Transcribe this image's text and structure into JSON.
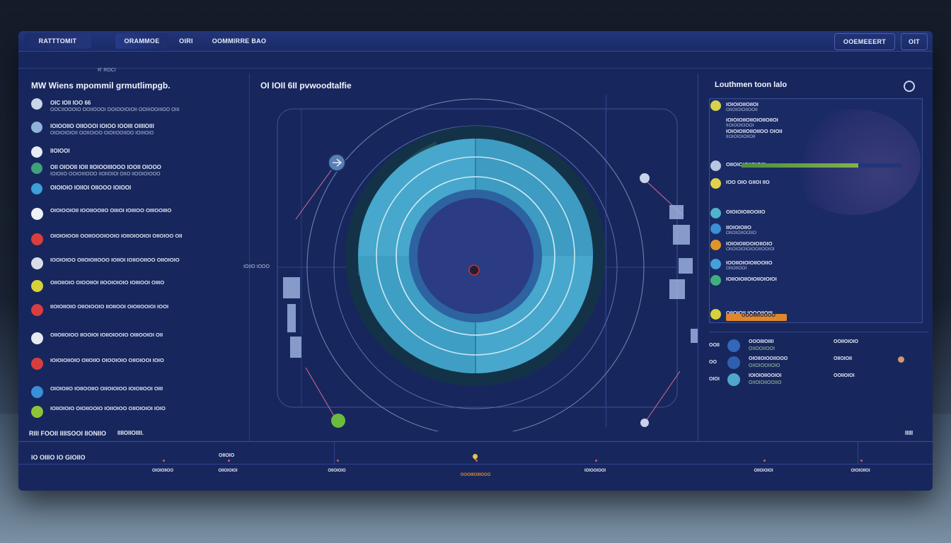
{
  "topbar": {
    "tabs": [
      "RATTTOMIT",
      "ORAMMOE",
      "OIRI",
      "OOMMIRRE BAO"
    ],
    "right_buttons": [
      "OOEMEEERT",
      "OIT"
    ]
  },
  "left_panel": {
    "mini_label": "R’ ROCI",
    "title": "MW Wiens mpommil grmutlimpgb.",
    "rows": [
      {
        "icon": "info-icon",
        "color": "#c9d6ea",
        "line1": "OIC IOII IOO 66",
        "line2": "OOCIIOOOIO OOIIOOOI OOIOOIOIOII OOIIIOOIIIOO OIII"
      },
      {
        "icon": "cloud-icon",
        "color": "#8fb3d8",
        "line1": "IOIOOIIO OIIOOOI IOIOO IOOIII OIIIIOIII",
        "line2": "OIOIOIOIOII OOIIOIOO OIOIIOOIIOO IOIIIOIO"
      },
      {
        "icon": "drop-icon",
        "color": "#e8ecf5",
        "line1": "IIOIOOI",
        "line2": ""
      },
      {
        "icon": "leaf-icon",
        "color": "#3fa07c",
        "line1": "OII OIOOII IOII IIOIOOIIIOOO IOOII OIOOO",
        "line2": "IOIOIIO OOIOIIIOOO IIOIIOIOI OIIO IIOOIOIOOO"
      },
      {
        "icon": "water-icon",
        "color": "#3ea0d8",
        "line1": "OIOIOIO IOIIOI OIIOOO IOIOOI",
        "line2": ""
      }
    ],
    "paragraphs": [
      {
        "icon": "drop-icon",
        "color": "#eef1f7",
        "text": "OIOIOOIOII IOOIIOOIIO OIIIOI IOIIIOO OIIIOOIIIO"
      },
      {
        "icon": "alert-icon",
        "color": "#d93e3e",
        "text": "OIOIOIOOII OOIIOOOIOOIO IOIIOIOOIOI OIIOIOO OII"
      },
      {
        "icon": "cloud-icon",
        "color": "#d8dde8",
        "text": "IOOIOIOO OIIOIOIIOOO IOIIOI IOIIOOIIOO OIIOIOIO"
      },
      {
        "icon": "sun-icon",
        "color": "#d8d23a",
        "text": "OIIOIIOIO OIOOIIOI IIOOIOIOIO IOIIIOOI OIIIO"
      },
      {
        "icon": "alert-icon",
        "color": "#d93e3e",
        "text": "IIOIOIIOIO OIIOIOOIO IIOIIOOI OIOIIOOIOI IOOI"
      },
      {
        "icon": "plane-icon",
        "color": "#e6e9f1",
        "text": "OIIOIIOIOO IIOOIOI IOIIOIOOIO OIIIOOIOI OII"
      },
      {
        "icon": "alert-icon",
        "color": "#d93e3e",
        "text": "IOIOIOIIOIO OIIOIIO OIOOIOIO OIIOIOOI IOIO"
      },
      {
        "icon": "globe-icon",
        "color": "#3a8fd6",
        "text": "OIOIOIIO IOIIOOIIO OIIOIOIOO IOIOIIOOI OIII"
      },
      {
        "icon": "leaf-icon",
        "color": "#8fc43a",
        "text": "IOIIOIOIO OIOIIOOIO IOIIOIOO OIIOIOIOI IOIO"
      }
    ]
  },
  "center": {
    "title": "OI IOII 6II pvwoodtalfie",
    "side_label": "IOIIO IOOO"
  },
  "right_panel": {
    "title": "Louthmen toon lalo",
    "rows": [
      {
        "icon": "sun-icon",
        "color": "#d6d24a",
        "line1": "IOIOIOIIOIIOI",
        "line2": "OIIOIOIOIIOOII"
      },
      {
        "icon": "",
        "color": "",
        "line1": "IOIOIOIIOIIOIOIIOIIOI",
        "line2": "IIOIOOIOOOI"
      },
      {
        "icon": "",
        "color": "",
        "line1": "IOIOIOIIOIIOIIOO OIOII",
        "line2": "IIOIOIOIOIIOII"
      },
      {
        "icon": "info-icon",
        "color": "#b9c6e0",
        "line1": "OIIOIOIOIIOIOIII",
        "line2": ""
      },
      {
        "icon": "sun-icon",
        "color": "#e2d24a",
        "line1": "IOO OIO GIIOI IIO",
        "line2": ""
      },
      {
        "icon": "info-icon",
        "color": "#4fb3c9",
        "line1": "OIOIOIOIIOOIIO",
        "line2": ""
      },
      {
        "icon": "info-icon",
        "color": "#3a8fd6",
        "line1": "IIOIOIOIIO",
        "line2": "OIIOIOIIOOIIO"
      },
      {
        "icon": "alert-icon",
        "color": "#e0952b",
        "line1": "IOIOIOIIOOIOIIOIO",
        "line2": "OIIOIOIOIOIOOIIOOIOI"
      },
      {
        "icon": "info-icon",
        "color": "#44a0d9",
        "line1": "IOOIIOIOIOIIOOIIO",
        "line2": "OIIOIIOOI"
      },
      {
        "icon": "info-icon",
        "color": "#3fb07d",
        "line1": "IOIIOIOIIOIOIIOIOIOI",
        "line2": ""
      },
      {
        "icon": "sun-icon",
        "color": "#d8d23a",
        "line1": "OIIOIOII IOOOIIOIII",
        "line2": ""
      }
    ],
    "progress": 0.73,
    "highlight_label": "OOOMIIOOOO",
    "legend": [
      {
        "prefix": "OOII",
        "title": "OOOIIIOIIII",
        "sub": "OIIOOIIOOI",
        "right": "OOIIOIOIO",
        "color": "#3466b9"
      },
      {
        "prefix": "OO",
        "title": "OIOIIOIOOIIOOO",
        "sub": "OIIOIOOIIOIO",
        "right": "OIIOIOII",
        "color": "#2f5fb0"
      },
      {
        "prefix": "OIOI",
        "title": "IOIOIOIIOOIOI",
        "sub": "OIIOIOIIOOIIO",
        "right": "OOIIOIOI",
        "color": "#4fa7c9"
      }
    ]
  },
  "bottom": {
    "left_label": "RIII FOOII IIIISOOI IIONIIO",
    "left_label2": "IIIIOIIOIIII.",
    "title": "IO OIIIO IO GIOIIO",
    "right_label": "IIIII",
    "ticks": [
      "OIOIOIIOO",
      "OIIOIOIOI",
      "OIIOIOIO",
      "OOOIIIOIIIOOO",
      "IOIOOIOOI",
      "OIIOIOIOI",
      "OIOIOIIOI"
    ],
    "mid_label": "OIIOIO"
  },
  "colors": {
    "window_bg": "#17275d",
    "ring_cyan": "#49a8cc",
    "ring_dark": "#1e3d58",
    "accent_red": "#d93e3e",
    "accent_green": "#7fb34a"
  }
}
